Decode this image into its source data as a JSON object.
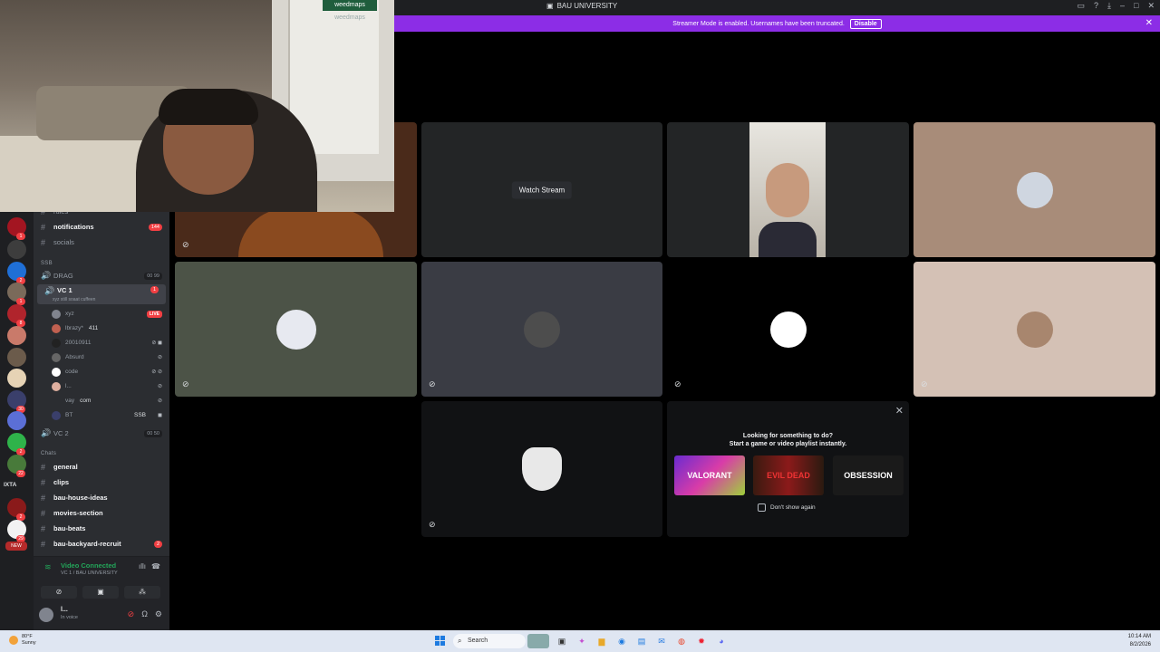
{
  "window": {
    "title": "BAU UNIVERSITY"
  },
  "banner": {
    "text": "Streamer Mode is enabled. Usernames have been truncated.",
    "button": "Disable"
  },
  "webcam": {
    "logo_top": "weedmaps",
    "logo_bottom": "weedmaps"
  },
  "rail": {
    "badges": [
      "1",
      "2",
      "1",
      "8",
      "30",
      "2",
      "22",
      "2",
      "29",
      "27",
      "NEW"
    ],
    "label": "IXTA"
  },
  "channels": {
    "rules": "rules",
    "notifications": "notifications",
    "notifications_badge": "144",
    "socials": "socials",
    "category_ssb": "SSB",
    "drag": "DRAG",
    "drag_count": "00",
    "drag_count2": "99",
    "vc1": "VC 1",
    "vc1_sub": "xyz still soaat cuffeen",
    "vc1_badge": "1",
    "vc2": "VC 2",
    "vc2_count": "00",
    "vc2_count2": "50",
    "category_chats": "Chats",
    "general": "general",
    "clips": "clips",
    "house": "bau-house-ideas",
    "movies": "movies-section",
    "beats": "bau-beats",
    "recruit": "bau-backyard-recruit",
    "recruit_badge": "2"
  },
  "voice_users": [
    {
      "name": "xyz",
      "extra": "LIVE"
    },
    {
      "name": "lbrazy*",
      "extra": "411"
    },
    {
      "name": "20010911",
      "extra": ""
    },
    {
      "name": "Absurd",
      "extra": ""
    },
    {
      "name": "code",
      "extra": ""
    },
    {
      "name": "l...",
      "extra": ""
    },
    {
      "name": "vay",
      "extra": "com"
    },
    {
      "name": "BT",
      "extra": "SSB"
    }
  ],
  "voice_panel": {
    "status": "Video Connected",
    "sub": "VC 1 / BAU UNIVERSITY"
  },
  "user": {
    "name": "l...",
    "status": "In voice"
  },
  "stage": {
    "watch_stream": "Watch Stream"
  },
  "activity": {
    "line1": "Looking for something to do?",
    "line2": "Start a game or video playlist instantly.",
    "cards": [
      "VALORANT",
      "EVIL DEAD",
      "OBSESSION"
    ],
    "dont_show": "Don't show again"
  },
  "taskbar": {
    "temp": "80°F",
    "weather": "Sunny",
    "search": "Search",
    "time": "10:14 AM",
    "date": "8/2/2026"
  },
  "colors": {
    "brand": "#5865f2",
    "banner": "#8c2de6",
    "danger": "#f23f43",
    "online": "#23a559"
  }
}
